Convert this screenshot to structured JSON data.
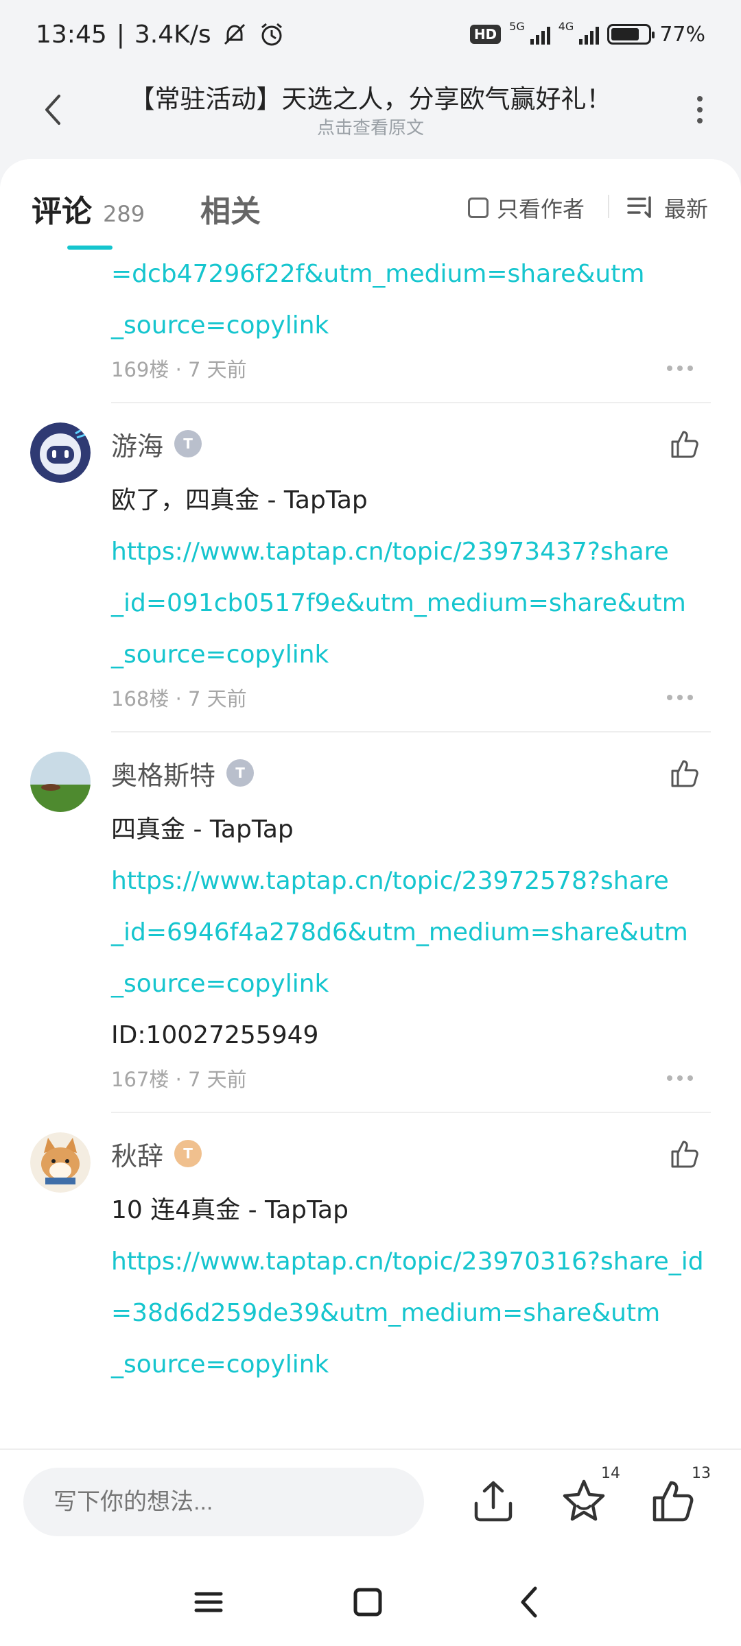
{
  "status_bar": {
    "time": "13:45",
    "speed": "3.4K/s",
    "hd": "HD",
    "net1": "5G",
    "net2": "4G",
    "battery": "77%",
    "battery_level": 0.77
  },
  "header": {
    "title": "【常驻活动】天选之人，分享欧气赢好礼！",
    "subtitle": "点击查看原文"
  },
  "tabs": {
    "comments_label": "评论",
    "comments_count": "289",
    "related_label": "相关",
    "author_only_label": "只看作者",
    "sort_label": "最新"
  },
  "comments": [
    {
      "partial": true,
      "lines": [
        {
          "type": "link",
          "text": "=dcb47296f22f&utm_medium=share&utm"
        },
        {
          "type": "link",
          "text": "_source=copylink"
        }
      ],
      "floor": "169楼",
      "time": "7 天前"
    },
    {
      "name": "游海",
      "level_badge": "T",
      "lines": [
        {
          "type": "text",
          "text": "欧了，四真金 - TapTap"
        },
        {
          "type": "link",
          "text": "https://www.taptap.cn/topic/23973437?share"
        },
        {
          "type": "link",
          "text": "_id=091cb0517f9e&utm_medium=share&utm"
        },
        {
          "type": "link",
          "text": "_source=copylink"
        }
      ],
      "floor": "168楼",
      "time": "7 天前"
    },
    {
      "name": "奥格斯特",
      "level_badge": "T",
      "lines": [
        {
          "type": "text",
          "text": "四真金 - TapTap"
        },
        {
          "type": "link",
          "text": "https://www.taptap.cn/topic/23972578?share"
        },
        {
          "type": "link",
          "text": "_id=6946f4a278d6&utm_medium=share&utm"
        },
        {
          "type": "link",
          "text": "_source=copylink"
        },
        {
          "type": "text",
          "text": "ID:10027255949"
        }
      ],
      "floor": "167楼",
      "time": "7 天前"
    },
    {
      "name": "秋辞",
      "level_badge": "T",
      "lines": [
        {
          "type": "text",
          "text": "10 连4真金 - TapTap"
        },
        {
          "type": "link",
          "text": "https://www.taptap.cn/topic/23970316?share_id"
        },
        {
          "type": "link",
          "text": "=38d6d259de39&utm_medium=share&utm"
        },
        {
          "type": "link",
          "text": "_source=copylink"
        }
      ]
    }
  ],
  "meta_separator": " · ",
  "bottom_bar": {
    "input_placeholder": "写下你的想法...",
    "favorite_count": "14",
    "like_count": "13"
  },
  "colors": {
    "accent": "#15c5ce",
    "text": "#222222",
    "muted": "#a6a6a6"
  }
}
